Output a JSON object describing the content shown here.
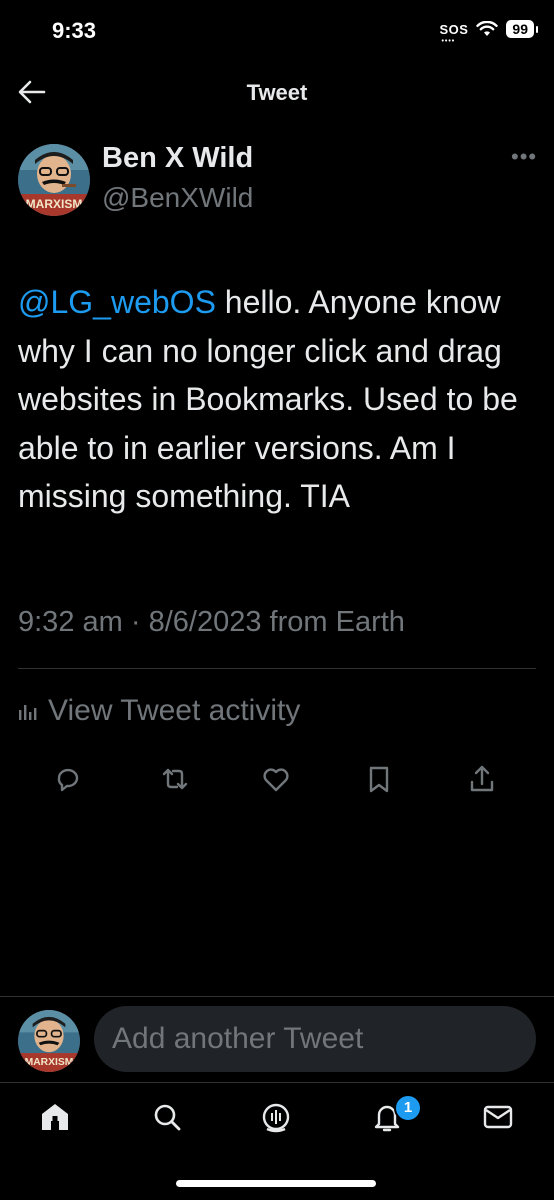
{
  "status_bar": {
    "time": "9:33",
    "sos": "SOS",
    "battery": "99"
  },
  "header": {
    "title": "Tweet"
  },
  "author": {
    "name": "Ben X Wild",
    "handle": "@BenXWild",
    "avatar_text": "MARXISM"
  },
  "tweet": {
    "mention": "@LG_webOS",
    "text": " hello. Anyone know why I can no longer click and drag websites in Bookmarks. Used to be able to in earlier versions. Am I missing something. TIA",
    "time": "9:32 am",
    "separator": "·",
    "date": "8/6/2023",
    "source": "from Earth"
  },
  "activity": {
    "label": "View Tweet activity"
  },
  "actions": [
    "reply-icon",
    "retweet-icon",
    "like-icon",
    "bookmark-icon",
    "share-icon"
  ],
  "reply": {
    "placeholder": "Add another Tweet"
  },
  "nav": {
    "items": [
      "home-icon",
      "search-icon",
      "spaces-icon",
      "notifications-icon",
      "messages-icon"
    ],
    "notification_count": "1"
  },
  "colors": {
    "background": "#000000",
    "accent": "#1d9bf0",
    "secondary_text": "#71767b",
    "input_bg": "#202327"
  }
}
